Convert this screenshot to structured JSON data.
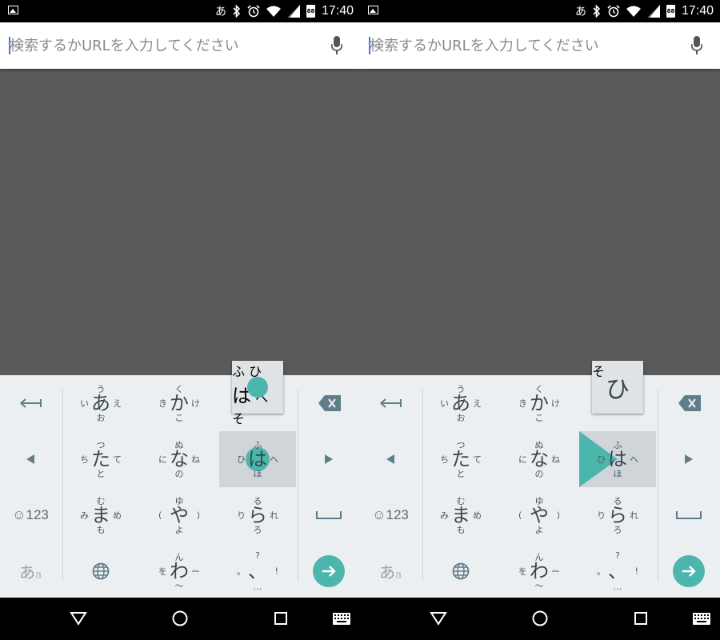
{
  "status_bar": {
    "ime_indicator": "あ",
    "time": "17:40",
    "battery_level": "88",
    "icons": [
      "image-icon",
      "bluetooth-icon",
      "alarm-icon",
      "wifi-icon",
      "signal-icon",
      "battery-icon"
    ]
  },
  "search": {
    "placeholder": "検索するかURLを入力してください"
  },
  "keyboard": {
    "a_key": {
      "main": "あ",
      "up": "う",
      "down": "お",
      "left": "い",
      "right": "え"
    },
    "ka_key": {
      "main": "か",
      "up": "く",
      "down": "こ",
      "left": "き",
      "right": "け"
    },
    "ha_key": {
      "main": "は",
      "up": "ふ",
      "down": "ほ",
      "left": "ひ",
      "right": "へ"
    },
    "ta_key": {
      "main": "た",
      "up": "つ",
      "down": "と",
      "left": "ち",
      "right": "て"
    },
    "na_key": {
      "main": "な",
      "up": "ぬ",
      "down": "の",
      "left": "に",
      "right": "ね"
    },
    "ma_key": {
      "main": "ま",
      "up": "む",
      "down": "も",
      "left": "み",
      "right": "め"
    },
    "ya_key": {
      "main": "や",
      "up": "ゆ",
      "down": "よ",
      "left": "(",
      "right": ")"
    },
    "ra_key": {
      "main": "ら",
      "up": "る",
      "down": "ろ",
      "left": "り",
      "right": "れ"
    },
    "wa_key": {
      "main": "わ",
      "up": "ん",
      "down": "〜",
      "left": "を",
      "right": "ー"
    },
    "punct_key": {
      "main": "、",
      "up": "?",
      "down": "…",
      "left": "。",
      "right": "!"
    },
    "symbols_label": "☺123",
    "mode_label_main": "あ",
    "mode_label_sub": "a",
    "popup_left": {
      "main": "は",
      "up": "ふ",
      "down": "そ",
      "left": "ひ",
      "right": "へ"
    },
    "popup_right": {
      "main": "ひ",
      "down": "そ"
    },
    "accent_color": "#4db6ac"
  },
  "navbar": {
    "icons": [
      "back-icon",
      "home-icon",
      "recents-icon",
      "keyboard-icon"
    ]
  }
}
